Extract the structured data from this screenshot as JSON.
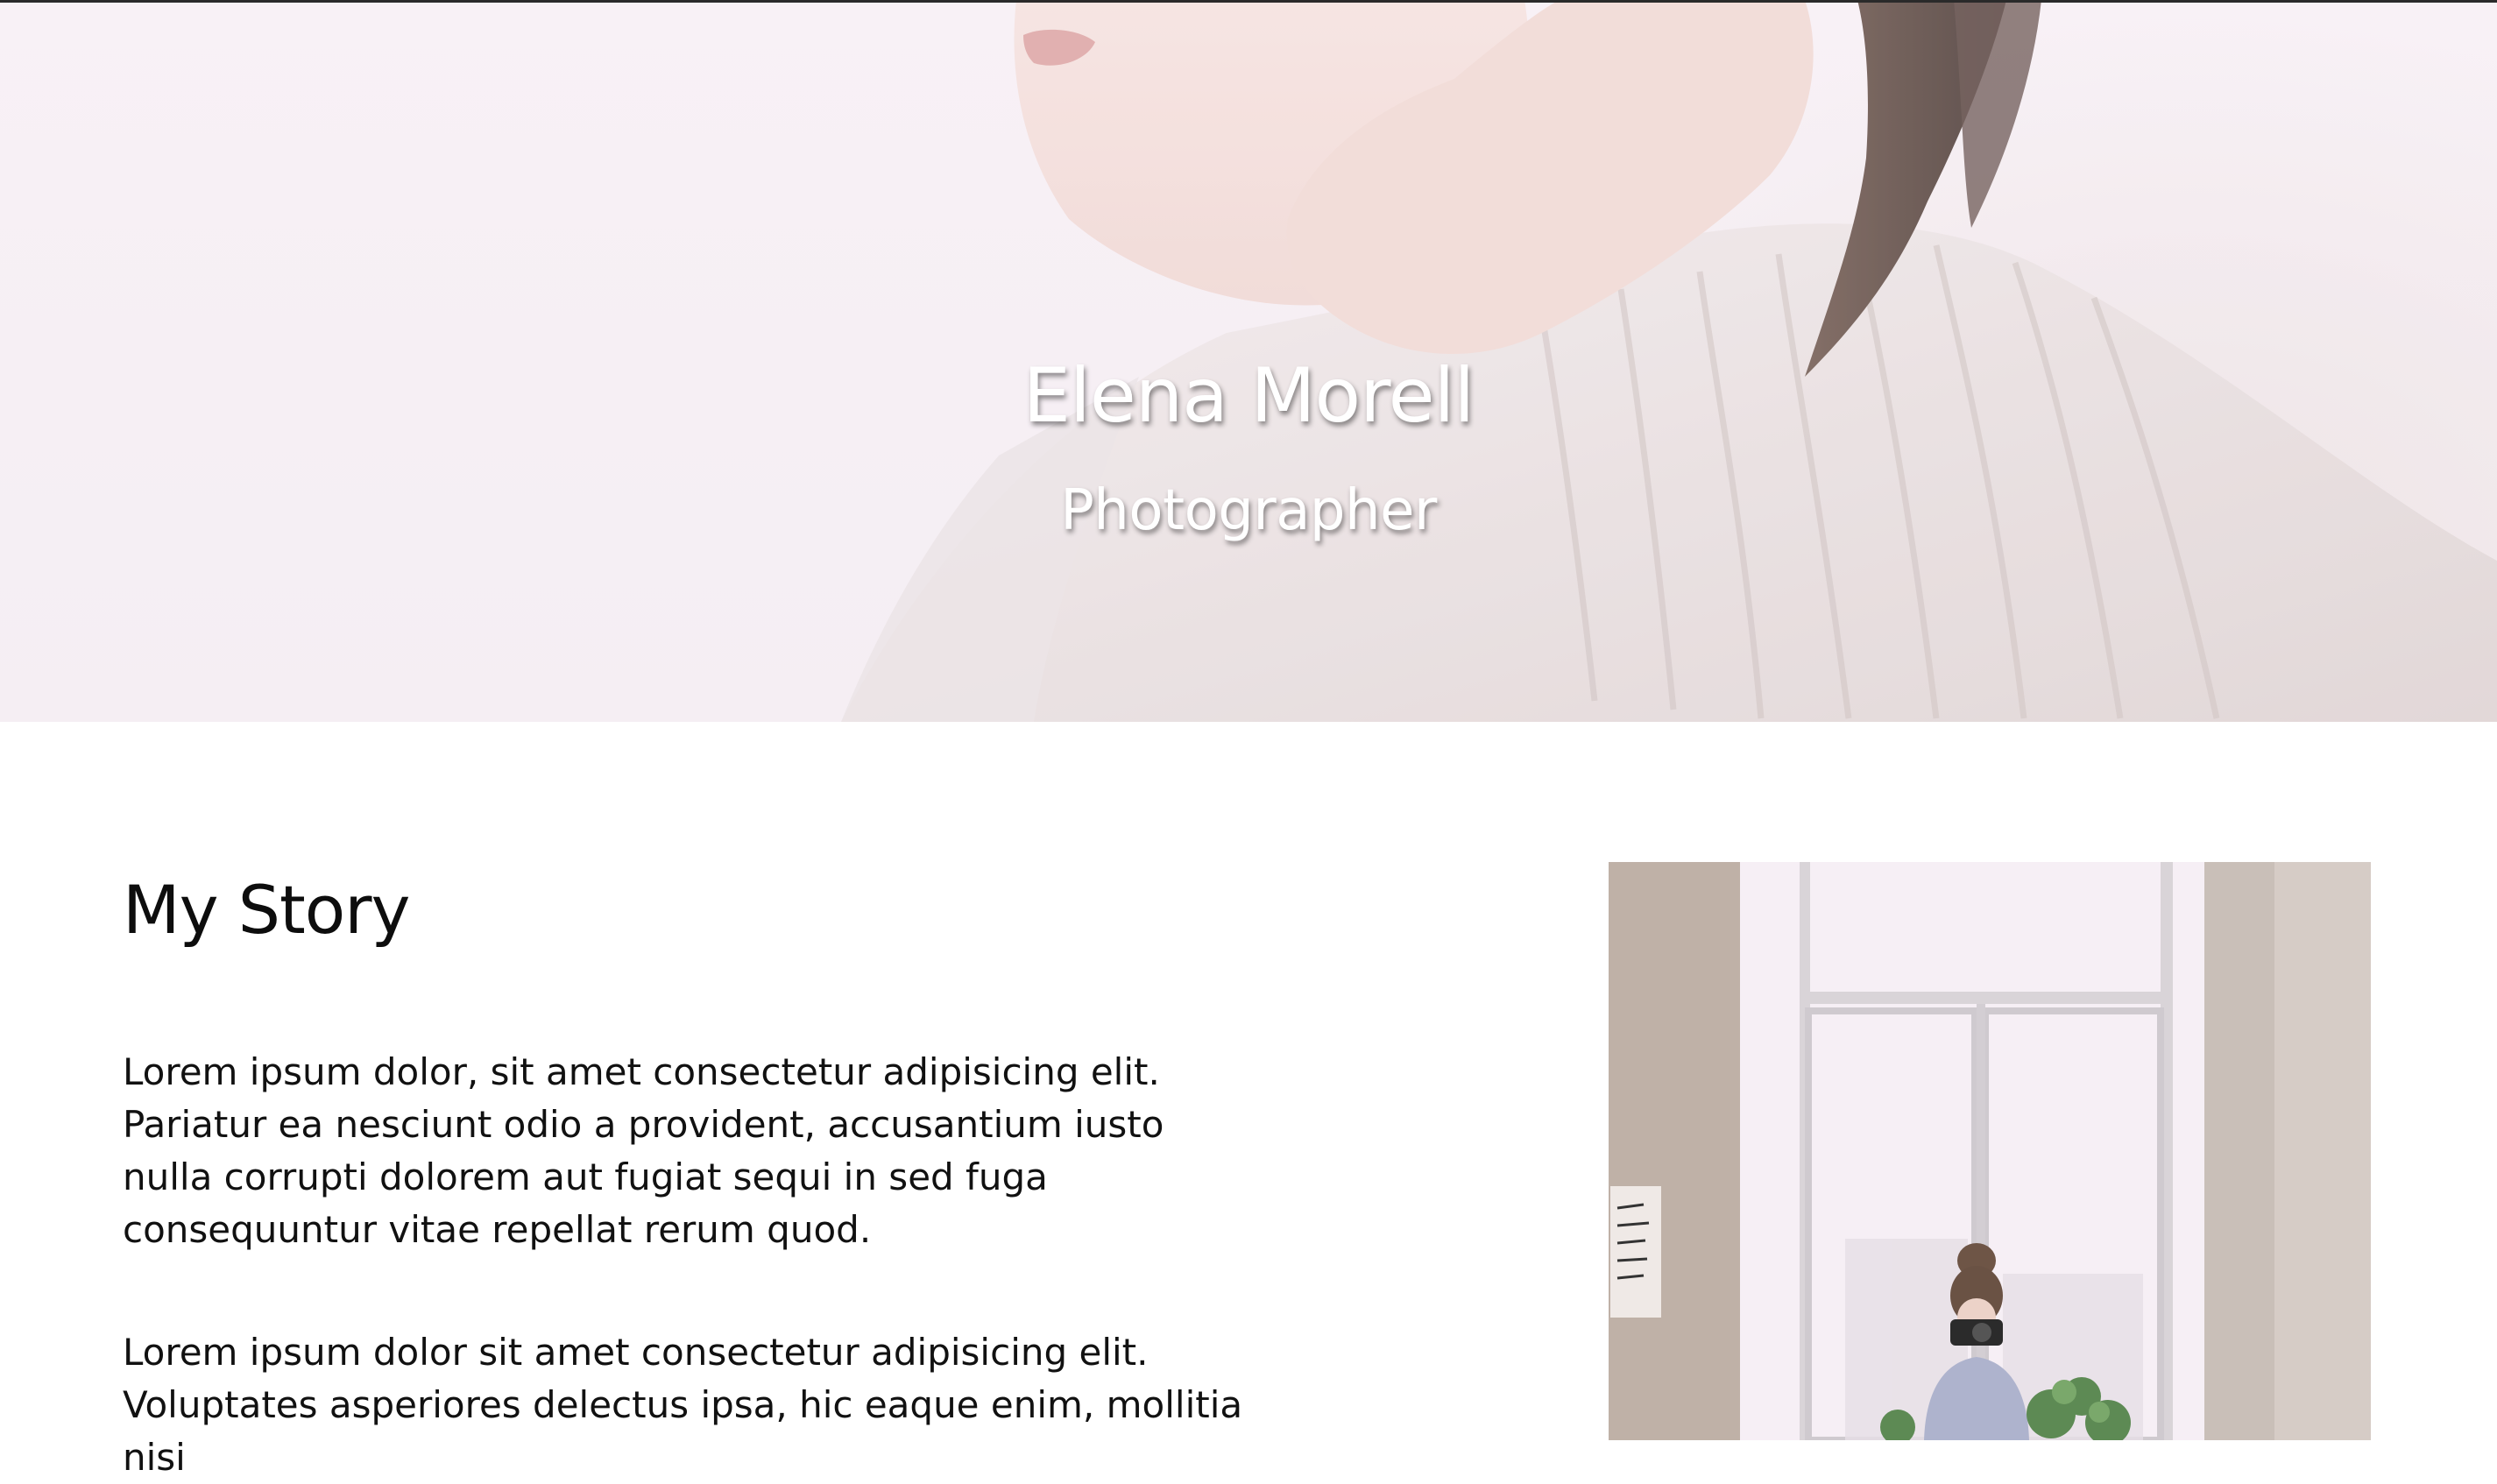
{
  "hero": {
    "name": "Elena Morell",
    "subtitle": "Photographer"
  },
  "story": {
    "title": "My Story",
    "paragraphs": [
      "Lorem ipsum dolor, sit amet consectetur adipisicing elit. Pariatur ea nesciunt odio a provident, accusantium iusto nulla corrupti dolorem aut fugiat sequi in sed fuga consequuntur vitae repellat rerum quod.",
      "Lorem ipsum dolor sit amet consectetur adipisicing elit. Voluptates asperiores delectus ipsa, hic eaque enim, mollitia nisi"
    ]
  },
  "colors": {
    "hero_tint": "#f6eff5",
    "text": "#111111",
    "heading_on_hero": "#ffffff"
  }
}
